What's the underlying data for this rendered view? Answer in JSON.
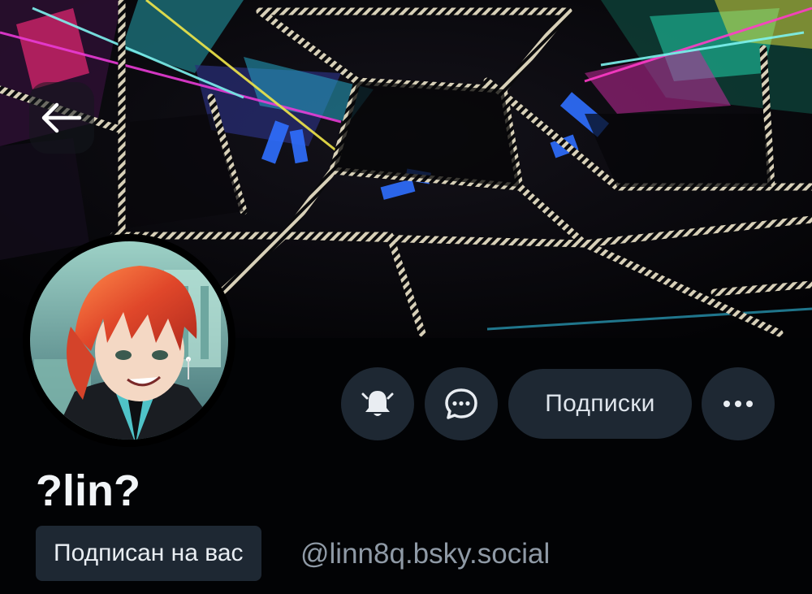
{
  "header": {
    "back_icon": "arrow-left-icon"
  },
  "profile": {
    "display_name": "?lin?",
    "handle": "@linn8q.bsky.social",
    "follows_you_label": "Подписан на вас",
    "avatar": "anime-avatar"
  },
  "actions": {
    "bell_icon": "bell-icon",
    "message_icon": "chat-bubble-icon",
    "following_label": "Подписки",
    "more_icon": "more-horizontal-icon"
  },
  "colors": {
    "background": "#020305",
    "button_background": "#1e2833",
    "primary_text": "#f2f5f8",
    "secondary_text": "#8f9aa6"
  }
}
